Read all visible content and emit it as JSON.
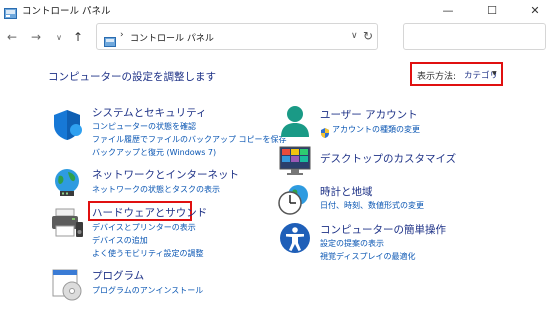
{
  "window": {
    "title": "コントロール パネル",
    "minimize": "—",
    "maximize": "☐",
    "close": "✕"
  },
  "nav": {
    "back": "←",
    "forward": "→",
    "recent": "∨",
    "up": "↑"
  },
  "address": {
    "separator": "›",
    "path": "コントロール パネル",
    "dropdown": "∨",
    "refresh": "↻"
  },
  "search": {
    "placeholder": ""
  },
  "main": {
    "title": "コンピューターの設定を調整します",
    "view_by": {
      "label": "表示方法:",
      "value": "カテゴリ",
      "caret": "▼"
    }
  },
  "categories_left": [
    {
      "icon": "shield-security-icon",
      "title": "システムとセキュリティ",
      "links": [
        "コンピューターの状態を確認",
        "ファイル履歴でファイルのバックアップ コピーを保存",
        "バックアップと復元 (Windows 7)"
      ]
    },
    {
      "icon": "network-globe-icon",
      "title": "ネットワークとインターネット",
      "links": [
        "ネットワークの状態とタスクの表示"
      ]
    },
    {
      "icon": "printer-hardware-icon",
      "title": "ハードウェアとサウンド",
      "links": [
        "デバイスとプリンターの表示",
        "デバイスの追加",
        "よく使うモビリティ設定の調整"
      ]
    },
    {
      "icon": "programs-disc-icon",
      "title": "プログラム",
      "links": [
        "プログラムのアンインストール"
      ]
    }
  ],
  "categories_right": [
    {
      "icon": "user-account-icon",
      "title": "ユーザー アカウント",
      "links": [
        "アカウントの種類の変更"
      ]
    },
    {
      "icon": "desktop-personalization-icon",
      "title": "デスクトップのカスタマイズ",
      "links": []
    },
    {
      "icon": "clock-globe-icon",
      "title": "時計と地域",
      "links": [
        "日付、時刻、数値形式の変更"
      ]
    },
    {
      "icon": "ease-of-access-icon",
      "title": "コンピューターの簡単操作",
      "links": [
        "設定の提案の表示",
        "視覚ディスプレイの最適化"
      ]
    }
  ],
  "colors": {
    "link": "#0a56b3",
    "title": "#1e3287",
    "highlight": "#e01010"
  }
}
